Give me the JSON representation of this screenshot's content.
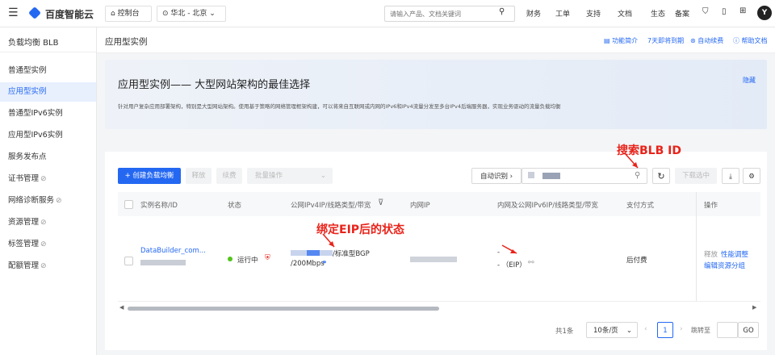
{
  "topbar": {
    "menu_icon": "menu-icon",
    "logo": "百度智能云",
    "console": "控制台",
    "region": "华北 - 北京",
    "search_placeholder": "请输入产品、文档关键词",
    "nav": [
      "财务",
      "工单",
      "支持",
      "文档",
      "生态",
      "备案"
    ],
    "avatar": "Y"
  },
  "sidebar": {
    "title": "负载均衡 BLB",
    "items": [
      {
        "label": "普通型实例"
      },
      {
        "label": "应用型实例"
      },
      {
        "label": "普通型IPv6实例"
      },
      {
        "label": "应用型IPv6实例"
      },
      {
        "label": "服务发布点"
      },
      {
        "label": "证书管理"
      },
      {
        "label": "网络诊断服务"
      },
      {
        "label": "资源管理"
      },
      {
        "label": "标签管理"
      },
      {
        "label": "配额管理"
      }
    ]
  },
  "header": {
    "title": "应用型实例",
    "links": [
      "功能简介",
      "7天即将到期",
      "自动续费",
      "帮助文档"
    ]
  },
  "banner": {
    "title": "应用型实例—— 大型网站架构的最佳选择",
    "hide": "隐藏",
    "desc": "针对用户复杂应用部署架构，特别是大型网站架构。使用基于策略的网络管理框架构建，可以将来自互联网或内网的IPv6和IPv4流量分发至多台IPv4后端服务器，实现业务驱动的流量负载均衡"
  },
  "toolbar": {
    "create": "+ 创建负载均衡",
    "release": "释放",
    "renew": "续费",
    "batch": "批量操作",
    "auto_detect": "自动识别",
    "selected_download": "下载选中"
  },
  "table": {
    "headers": [
      "实例名称/ID",
      "状态",
      "公网IPv4IP/线路类型/带宽",
      "内网IP",
      "内网及公网IPv6IP/线路类型/带宽",
      "支付方式",
      "操作"
    ],
    "row": {
      "name": "DataBuilder_com...",
      "status": "运行中",
      "ipv4_type": "/标准型BGP",
      "bandwidth": "/200Mbps",
      "ipv6_line1": "-",
      "ipv6_line2": "- （EIP）",
      "payment": "后付费",
      "actions": [
        "释放",
        "性能调整",
        "编辑资源分组"
      ]
    }
  },
  "pagination": {
    "total": "共1条",
    "page_size": "10条/页",
    "current_page": "1",
    "jump_label": "跳转至",
    "go": "GO"
  },
  "annotations": {
    "search": "搜索BLB ID",
    "eip": "绑定EIP后的状态"
  },
  "colors": {
    "primary": "#2468f2",
    "running": "#52c41a",
    "annotation": "#e8231a"
  }
}
